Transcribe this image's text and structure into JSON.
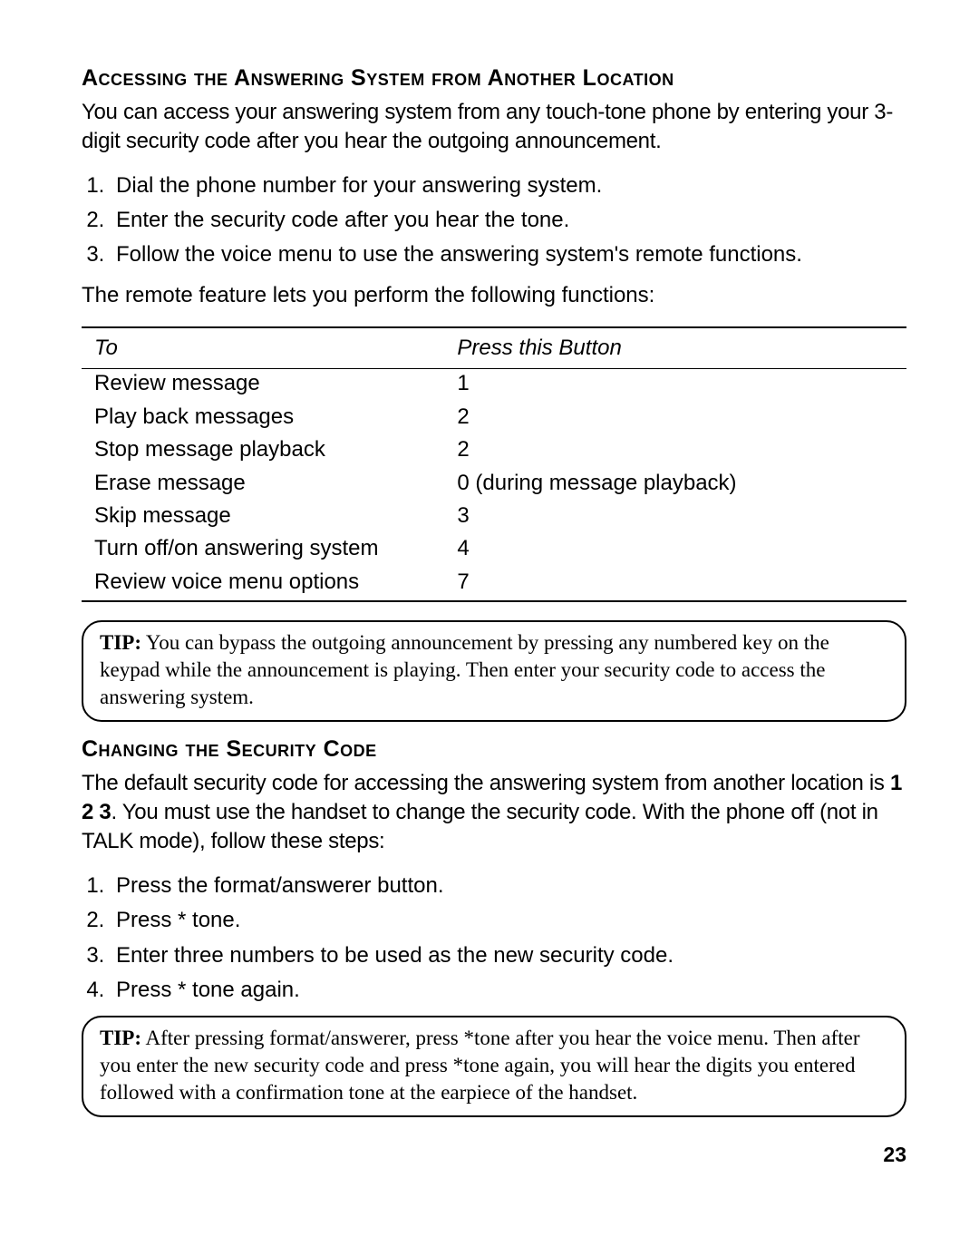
{
  "section1": {
    "heading": "Accessing the Answering System from Another Location",
    "intro": "You can access your answering system from any touch-tone phone by entering your 3-digit security code after you hear the outgoing announcement.",
    "steps": [
      "Dial the phone number for your answering system.",
      "Enter the security code after you hear the tone.",
      "Follow the voice menu to use the answering system's remote functions."
    ],
    "after_steps": "The remote feature lets you perform the following functions:"
  },
  "table": {
    "header": {
      "col1": "To",
      "col2": "Press this Button"
    },
    "rows": [
      {
        "to": "Review message",
        "btn": "1"
      },
      {
        "to": "Play back messages",
        "btn": "2"
      },
      {
        "to": "Stop message playback",
        "btn": "2"
      },
      {
        "to": "Erase message",
        "btn": "0 (during message playback)"
      },
      {
        "to": "Skip message",
        "btn": "3"
      },
      {
        "to": "Turn off/on answering system",
        "btn": "4"
      },
      {
        "to": "Review voice menu options",
        "btn": "7"
      }
    ]
  },
  "tip1": {
    "label": "TIP:",
    "text": " You can bypass the outgoing announcement by pressing any numbered key on the keypad while the announcement is playing. Then enter your security code to access the answering system."
  },
  "section2": {
    "heading": "Changing the Security Code",
    "intro_pre": "The default security code for accessing the answering system from another location is ",
    "intro_bold": "1 2 3",
    "intro_post": ". You must use the handset to change the security code. With the phone off (not in TALK mode), follow these steps:",
    "steps": [
      "Press the format/answerer button.",
      "Press * tone.",
      "Enter three numbers to be used as the new security code.",
      "Press * tone again."
    ]
  },
  "tip2": {
    "label": "TIP:",
    "text": " After pressing format/answerer, press *tone after you hear the voice menu. Then after you enter the new security code and press *tone again, you will hear the digits you entered followed with a confirmation tone at the earpiece of the handset."
  },
  "page_number": "23"
}
